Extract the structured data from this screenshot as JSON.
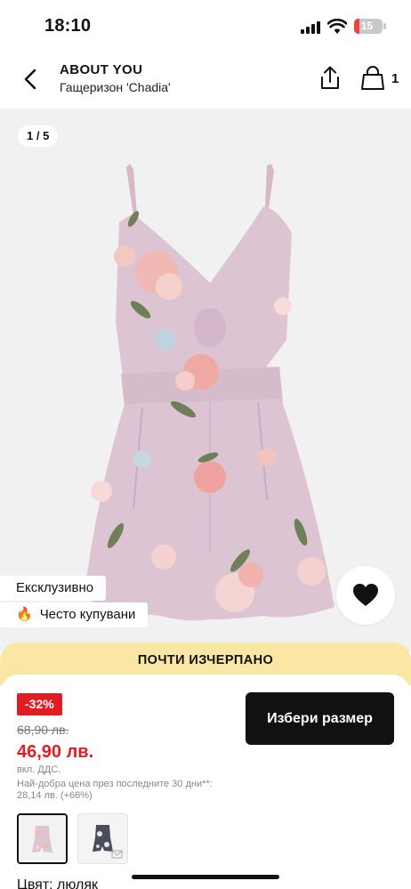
{
  "status_bar": {
    "time": "18:10",
    "battery": "15",
    "battery_level": 0.15
  },
  "header": {
    "brand": "ABOUT YOU",
    "product_name": "Гащеризон 'Chadia'",
    "bag_count": "1",
    "icons": [
      "chevron-left-icon",
      "share-icon",
      "shopping-bag-icon"
    ]
  },
  "gallery": {
    "pager": "1 / 5",
    "tags": {
      "exclusive": "Ексклузивно",
      "popular": "Често купувани"
    },
    "wishlist_icon": "heart-icon"
  },
  "stock": {
    "banner": "ПОЧТИ ИЗЧЕРПАНО"
  },
  "pricing": {
    "discount": "-32%",
    "old_price": "68,90 лв.",
    "new_price": "46,90 лв.",
    "vat": "вкл. ДДС.",
    "best_price": "Най-добра цена през последните 30 дни**: 28,14 лв. (+66%)"
  },
  "actions": {
    "select_size": "Избери размер"
  },
  "variants": {
    "color_label": "Цвят: люляк"
  },
  "colors": {
    "sale_red": "#e31b23",
    "banner_yellow": "#fbe7a5",
    "button_black": "#111111",
    "gallery_bg": "#f1f1f1"
  }
}
